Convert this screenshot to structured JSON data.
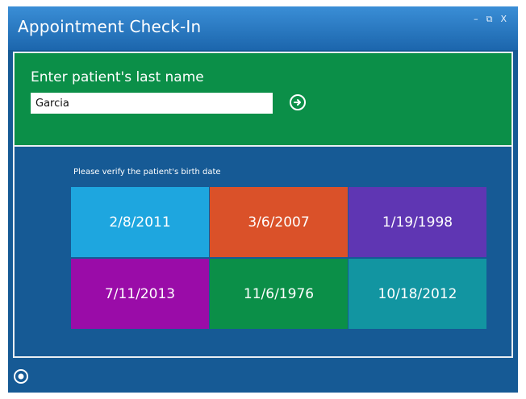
{
  "window": {
    "title": "Appointment Check-In",
    "controls": {
      "minimize": "–",
      "restore": "⧉",
      "close": "X"
    }
  },
  "search": {
    "label": "Enter patient's last name",
    "value": "Garcia",
    "go_icon": "arrow-right-circle-icon"
  },
  "verify": {
    "prompt": "Please verify the patient's birth date",
    "dates": [
      {
        "label": "2/8/2011",
        "color": "#1ea6df"
      },
      {
        "label": "3/6/2007",
        "color": "#da5129"
      },
      {
        "label": "1/19/1998",
        "color": "#5f36b3"
      },
      {
        "label": "7/11/2013",
        "color": "#9a0ca8"
      },
      {
        "label": "11/6/1976",
        "color": "#0b8f48"
      },
      {
        "label": "10/18/2012",
        "color": "#1295a1"
      }
    ]
  },
  "footer": {
    "settings_icon": "settings-icon"
  },
  "colors": {
    "window_bg": "#165a95",
    "title_bar": "#2a7bc4",
    "search_panel": "#0b8f48"
  }
}
